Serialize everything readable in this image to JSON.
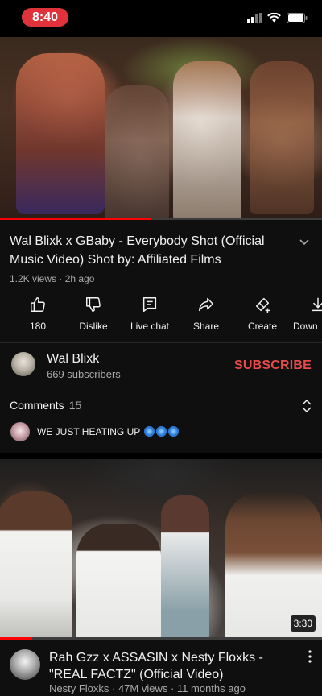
{
  "status_bar": {
    "time": "8:40"
  },
  "player": {
    "progress_fraction": 0.47
  },
  "video": {
    "title": "Wal Blixk x GBaby - Everybody Shot (Official Music Video) Shot by: Affiliated Films",
    "meta": "1.2K views · 2h ago"
  },
  "actions": [
    {
      "label": "180",
      "icon": "thumbs-up-icon"
    },
    {
      "label": "Dislike",
      "icon": "thumbs-down-icon"
    },
    {
      "label": "Live chat",
      "icon": "live-chat-icon"
    },
    {
      "label": "Share",
      "icon": "share-icon"
    },
    {
      "label": "Create",
      "icon": "create-icon"
    },
    {
      "label": "Down",
      "icon": "download-icon"
    }
  ],
  "channel": {
    "name": "Wal Blixk",
    "subscribers": "669 subscribers",
    "subscribe_label": "SUBSCRIBE"
  },
  "comments": {
    "label": "Comments",
    "count": "15",
    "top_comment": "WE JUST HEATING UP"
  },
  "next_video": {
    "duration": "3:30",
    "progress_fraction": 0.1,
    "title": "Rah Gzz x ASSASIN x Nesty Floxks - \"REAL FACTZ\" (Official Video)",
    "meta": "Nesty Floxks · 47M views · 11 months ago"
  },
  "colors": {
    "accent": "#ff0000",
    "subscribe": "#e94a4a",
    "background": "#0f0f0f"
  }
}
